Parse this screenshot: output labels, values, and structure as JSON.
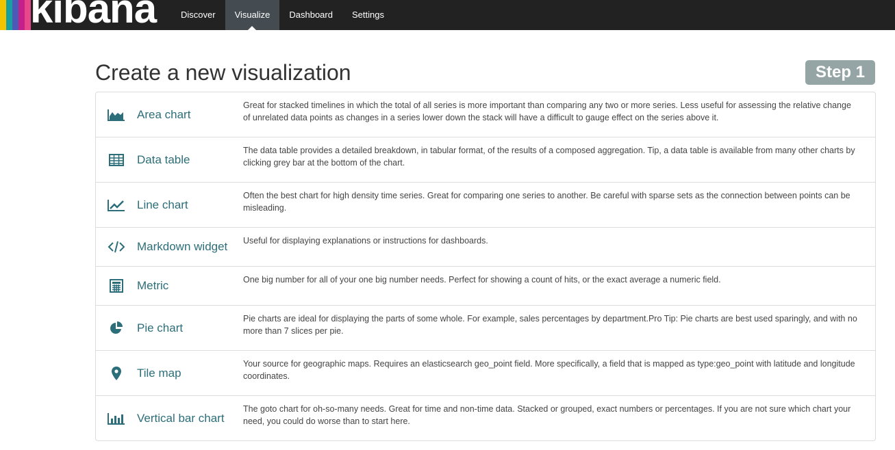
{
  "app": {
    "logo_text": "kibana"
  },
  "colors": {
    "nav_bg": "#222222",
    "active_tab": "#444c52",
    "link": "#2c6e79",
    "badge": "#95a5a6",
    "stripes": [
      "#f2c400",
      "#1a9fa1",
      "#4c5ab7",
      "#c3208a",
      "#e8488b"
    ]
  },
  "nav": {
    "tabs": [
      {
        "label": "Discover",
        "active": false
      },
      {
        "label": "Visualize",
        "active": true
      },
      {
        "label": "Dashboard",
        "active": false
      },
      {
        "label": "Settings",
        "active": false
      }
    ]
  },
  "page": {
    "title": "Create a new visualization",
    "step": "Step 1"
  },
  "visualizations": [
    {
      "icon": "area-chart-icon",
      "label": "Area chart",
      "description": "Great for stacked timelines in which the total of all series is more important than comparing any two or more series. Less useful for assessing the relative change of unrelated data points as changes in a series lower down the stack will have a difficult to gauge effect on the series above it."
    },
    {
      "icon": "table-icon",
      "label": "Data table",
      "description": "The data table provides a detailed breakdown, in tabular format, of the results of a composed aggregation. Tip, a data table is available from many other charts by clicking grey bar at the bottom of the chart."
    },
    {
      "icon": "line-chart-icon",
      "label": "Line chart",
      "description": "Often the best chart for high density time series. Great for comparing one series to another. Be careful with sparse sets as the connection between points can be misleading."
    },
    {
      "icon": "code-icon",
      "label": "Markdown widget",
      "description": "Useful for displaying explanations or instructions for dashboards."
    },
    {
      "icon": "calculator-icon",
      "label": "Metric",
      "description": "One big number for all of your one big number needs. Perfect for showing a count of hits, or the exact average a numeric field."
    },
    {
      "icon": "pie-chart-icon",
      "label": "Pie chart",
      "description": "Pie charts are ideal for displaying the parts of some whole. For example, sales percentages by department.Pro Tip: Pie charts are best used sparingly, and with no more than 7 slices per pie."
    },
    {
      "icon": "map-marker-icon",
      "label": "Tile map",
      "description": "Your source for geographic maps. Requires an elasticsearch geo_point field. More specifically, a field that is mapped as type:geo_point with latitude and longitude coordinates."
    },
    {
      "icon": "bar-chart-icon",
      "label": "Vertical bar chart",
      "description": "The goto chart for oh-so-many needs. Great for time and non-time data. Stacked or grouped, exact numbers or percentages. If you are not sure which chart your need, you could do worse than to start here."
    }
  ]
}
